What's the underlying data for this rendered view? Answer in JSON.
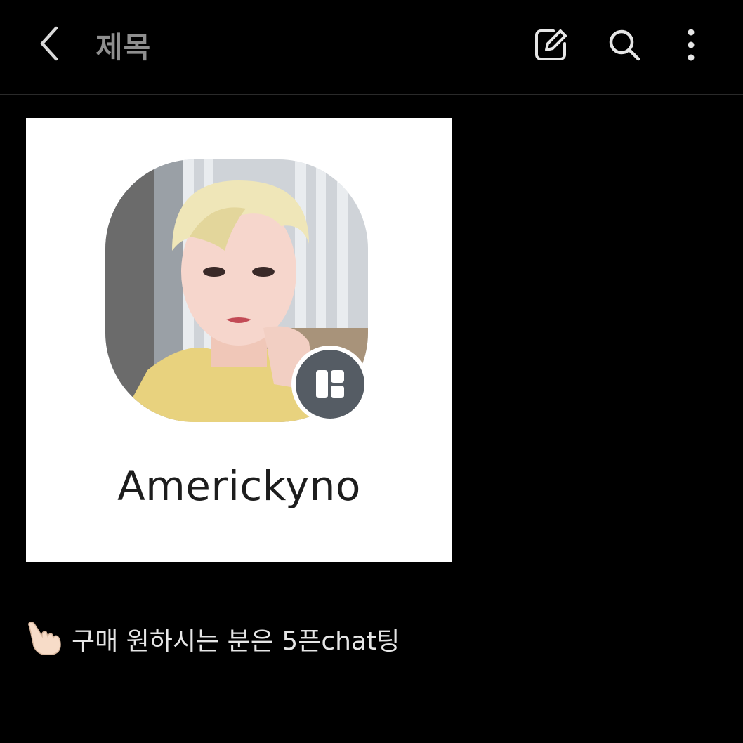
{
  "header": {
    "title": "제목",
    "back_icon": "chevron-left-icon",
    "edit_icon": "edit-icon",
    "search_icon": "search-icon",
    "more_icon": "more-vertical-icon"
  },
  "card": {
    "name": "Americkyno",
    "badge_icon": "open-profile-icon",
    "background": "#ffffff",
    "badge_color": "#555c64"
  },
  "message": {
    "emoji": "pointing-hand-icon",
    "text": "구매 원하시는 분은 5픈chat팅"
  },
  "colors": {
    "background": "#000000",
    "title": "#8f8f8f",
    "text": "#e6e6e6"
  }
}
